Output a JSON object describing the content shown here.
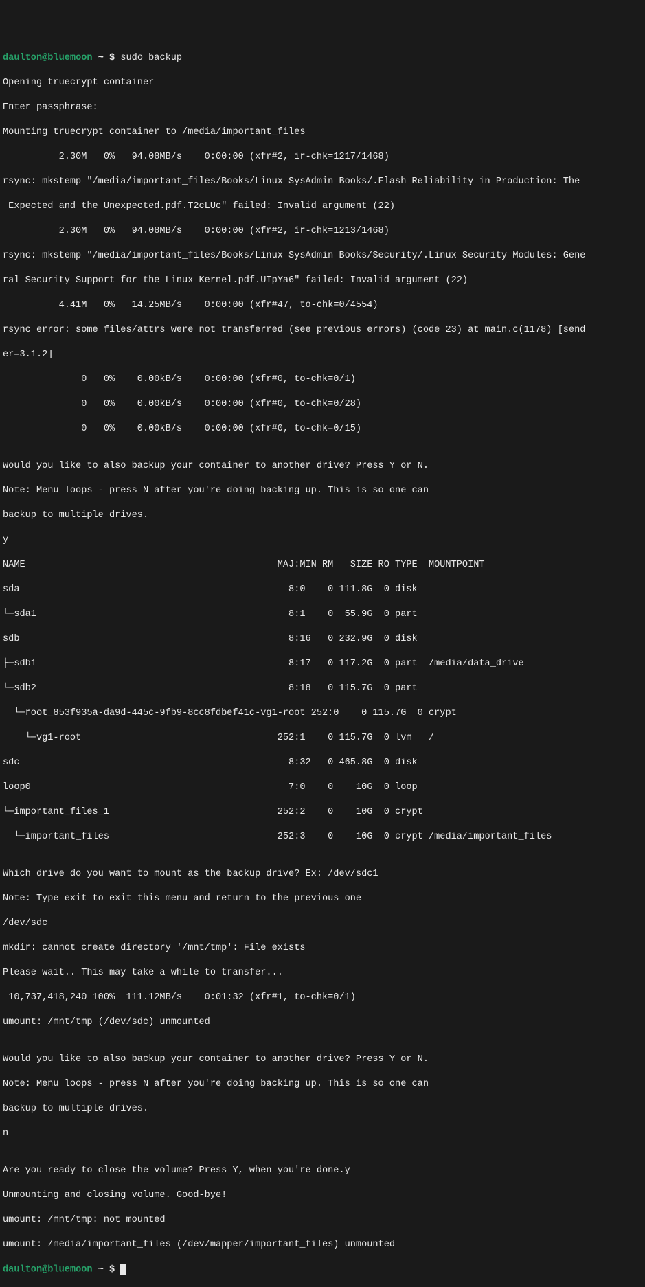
{
  "prompt1": {
    "user": "daulton",
    "at": "@",
    "host": "bluemoon",
    "path": " ~ ",
    "dollar": "$ ",
    "command": "sudo backup"
  },
  "lines": {
    "l01": "Opening truecrypt container",
    "l02": "Enter passphrase:",
    "l03": "Mounting truecrypt container to /media/important_files",
    "l04": "          2.30M   0%   94.08MB/s    0:00:00 (xfr#2, ir-chk=1217/1468)",
    "l05": "rsync: mkstemp \"/media/important_files/Books/Linux SysAdmin Books/.Flash Reliability in Production: The",
    "l06": " Expected and the Unexpected.pdf.T2cLUc\" failed: Invalid argument (22)",
    "l07": "          2.30M   0%   94.08MB/s    0:00:00 (xfr#2, ir-chk=1213/1468)",
    "l08": "rsync: mkstemp \"/media/important_files/Books/Linux SysAdmin Books/Security/.Linux Security Modules: Gene",
    "l09": "ral Security Support for the Linux Kernel.pdf.UTpYa6\" failed: Invalid argument (22)",
    "l10": "          4.41M   0%   14.25MB/s    0:00:00 (xfr#47, to-chk=0/4554)",
    "l11": "rsync error: some files/attrs were not transferred (see previous errors) (code 23) at main.c(1178) [send",
    "l12": "er=3.1.2]",
    "l13": "              0   0%    0.00kB/s    0:00:00 (xfr#0, to-chk=0/1)",
    "l14": "              0   0%    0.00kB/s    0:00:00 (xfr#0, to-chk=0/28)",
    "l15": "              0   0%    0.00kB/s    0:00:00 (xfr#0, to-chk=0/15)",
    "l16": "",
    "l17": "Would you like to also backup your container to another drive? Press Y or N.",
    "l18": "Note: Menu loops - press N after you're doing backing up. This is so one can",
    "l19": "backup to multiple drives.",
    "l20": "y",
    "l21": "NAME                                             MAJ:MIN RM   SIZE RO TYPE  MOUNTPOINT",
    "l22": "sda                                                8:0    0 111.8G  0 disk",
    "l23": "└─sda1                                             8:1    0  55.9G  0 part",
    "l24": "sdb                                                8:16   0 232.9G  0 disk",
    "l25": "├─sdb1                                             8:17   0 117.2G  0 part  /media/data_drive",
    "l26": "└─sdb2                                             8:18   0 115.7G  0 part",
    "l27": "  └─root_853f935a-da9d-445c-9fb9-8cc8fdbef41c-vg1-root 252:0    0 115.7G  0 crypt",
    "l28": "    └─vg1-root                                   252:1    0 115.7G  0 lvm   /",
    "l29": "sdc                                                8:32   0 465.8G  0 disk",
    "l30": "loop0                                              7:0    0    10G  0 loop",
    "l31": "└─important_files_1                              252:2    0    10G  0 crypt",
    "l32": "  └─important_files                              252:3    0    10G  0 crypt /media/important_files",
    "l33": "",
    "l34": "Which drive do you want to mount as the backup drive? Ex: /dev/sdc1",
    "l35": "Note: Type exit to exit this menu and return to the previous one",
    "l36": "/dev/sdc",
    "l37": "mkdir: cannot create directory '/mnt/tmp': File exists",
    "l38": "Please wait.. This may take a while to transfer...",
    "l39": " 10,737,418,240 100%  111.12MB/s    0:01:32 (xfr#1, to-chk=0/1)",
    "l40": "umount: /mnt/tmp (/dev/sdc) unmounted",
    "l41": "",
    "l42": "Would you like to also backup your container to another drive? Press Y or N.",
    "l43": "Note: Menu loops - press N after you're doing backing up. This is so one can",
    "l44": "backup to multiple drives.",
    "l45": "n",
    "l46": "",
    "l47": "Are you ready to close the volume? Press Y, when you're done.y",
    "l48": "Unmounting and closing volume. Good-bye!",
    "l49": "umount: /mnt/tmp: not mounted",
    "l50": "umount: /media/important_files (/dev/mapper/important_files) unmounted"
  },
  "prompt2": {
    "user": "daulton",
    "at": "@",
    "host": "bluemoon",
    "path": " ~ ",
    "dollar": "$ "
  }
}
